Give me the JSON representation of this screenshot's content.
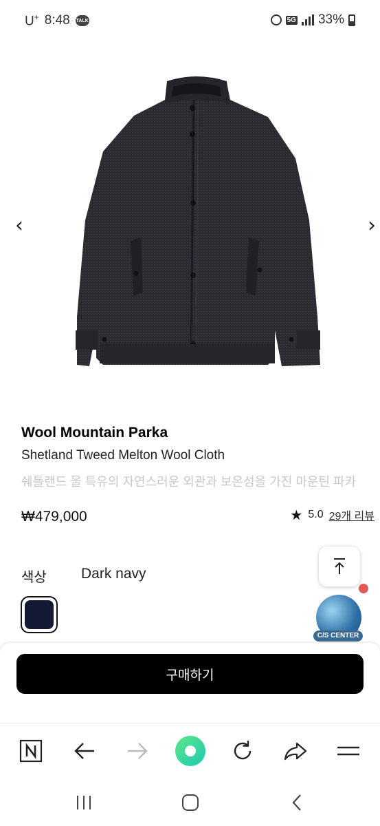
{
  "status_bar": {
    "carrier": "U",
    "carrier_sup": "+",
    "time": "8:48",
    "talk_badge": "TALK",
    "network": "5G",
    "battery": "33%"
  },
  "carousel": {
    "prev_label": "‹",
    "next_label": "›"
  },
  "product": {
    "name": "Wool Mountain Parka",
    "subtitle": "Shetland Tweed Melton Wool Cloth",
    "description": "쉐틀랜드 울 특유의 자연스러운 외관과 보온성을 가진 마운틴 파카",
    "price": "₩479,000",
    "rating": "5.0",
    "review_link": "29개 리뷰",
    "color_label": "색상",
    "color_value": "Dark navy",
    "swatch_color": "#141a33"
  },
  "cs_center": {
    "label": "C/S CENTER"
  },
  "buy_sheet": {
    "button_label": "구매하기"
  },
  "browser_toolbar": {
    "accent_color": "#3ddc84"
  }
}
